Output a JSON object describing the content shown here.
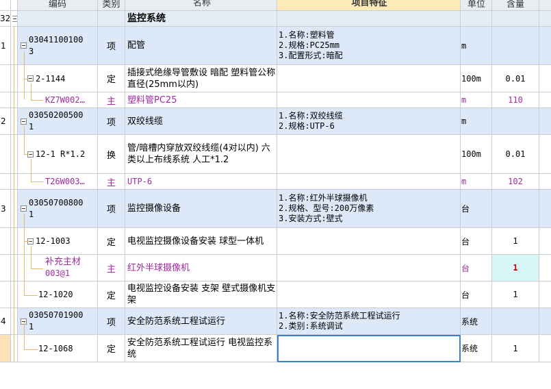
{
  "headers": {
    "code": "编码",
    "type": "类别",
    "name": "名称",
    "feature": "项目特征",
    "unit": "单位",
    "qty": "含量"
  },
  "section": {
    "index": "32",
    "name": "监控系统"
  },
  "rows": [
    {
      "index": "1",
      "code_line1": "03041100100",
      "code_line2": "3",
      "type": "项",
      "name": "配管",
      "feat": [
        "1.名称:塑料管",
        "2.规格:PC25mm",
        "3.配置形式:暗配"
      ],
      "unit": "m",
      "qty": ""
    },
    {
      "code": "2-1144",
      "type": "定",
      "name": "插接式绝缘导管敷设 暗配 塑料管公称直径(25mm以内)",
      "unit": "100m",
      "qty": "0.01"
    },
    {
      "code": "KZ7W002…",
      "type": "主",
      "name": "塑料管PC25",
      "unit": "m",
      "qty": "110"
    },
    {
      "index": "2",
      "code_line1": "03050200500",
      "code_line2": "1",
      "type": "项",
      "name": "双绞线缆",
      "feat": [
        "1.名称:双绞线缆",
        "2.规格:UTP-6"
      ],
      "unit": "m",
      "qty": ""
    },
    {
      "code": "12-1 R*1.2",
      "type": "换",
      "name": "管/暗槽内穿放双绞线缆(4对以内)  六类以上布线系统 人工*1.2",
      "unit": "100m",
      "qty": "0.01"
    },
    {
      "code": "T26W003…",
      "type": "主",
      "name": "UTP-6",
      "unit": "m",
      "qty": "102"
    },
    {
      "index": "3",
      "code_line1": "03050700800",
      "code_line2": "1",
      "type": "项",
      "name": "监控摄像设备",
      "feat": [
        "1.名称:红外半球摄像机",
        "2.规格、型号:200万像素",
        "3.安装方式:壁式"
      ],
      "unit": "台",
      "qty": ""
    },
    {
      "code": "12-1003",
      "type": "定",
      "name": "电视监控摄像设备安装 球型一体机",
      "unit": "台",
      "qty": "1"
    },
    {
      "code_line1": "补充主材",
      "code_line2": "003@1",
      "type": "主",
      "name": "红外半球摄像机",
      "unit": "台",
      "qty": "1"
    },
    {
      "code": "12-1020",
      "type": "定",
      "name": "电视监控设备安装 支架 壁式摄像机支架",
      "unit": "台",
      "qty": "1"
    },
    {
      "index": "4",
      "code_line1": "03050701900",
      "code_line2": "1",
      "type": "项",
      "name": "安全防范系统工程试运行",
      "feat": [
        "1.名称:安全防范系统工程试运行",
        "2.类别:系统调试"
      ],
      "unit": "系统",
      "qty": ""
    },
    {
      "code": "12-1068",
      "type": "定",
      "name": "安全防范系统工程试运行 电视监控系统",
      "unit": "系统",
      "qty": "1"
    }
  ],
  "colors": {
    "header_bg": "#e9edf2",
    "item_row_bg": "#dde8f8",
    "material_text": "#a02aa0",
    "selected_border": "#3b7fd4",
    "highlight_qty": "#c00000"
  }
}
